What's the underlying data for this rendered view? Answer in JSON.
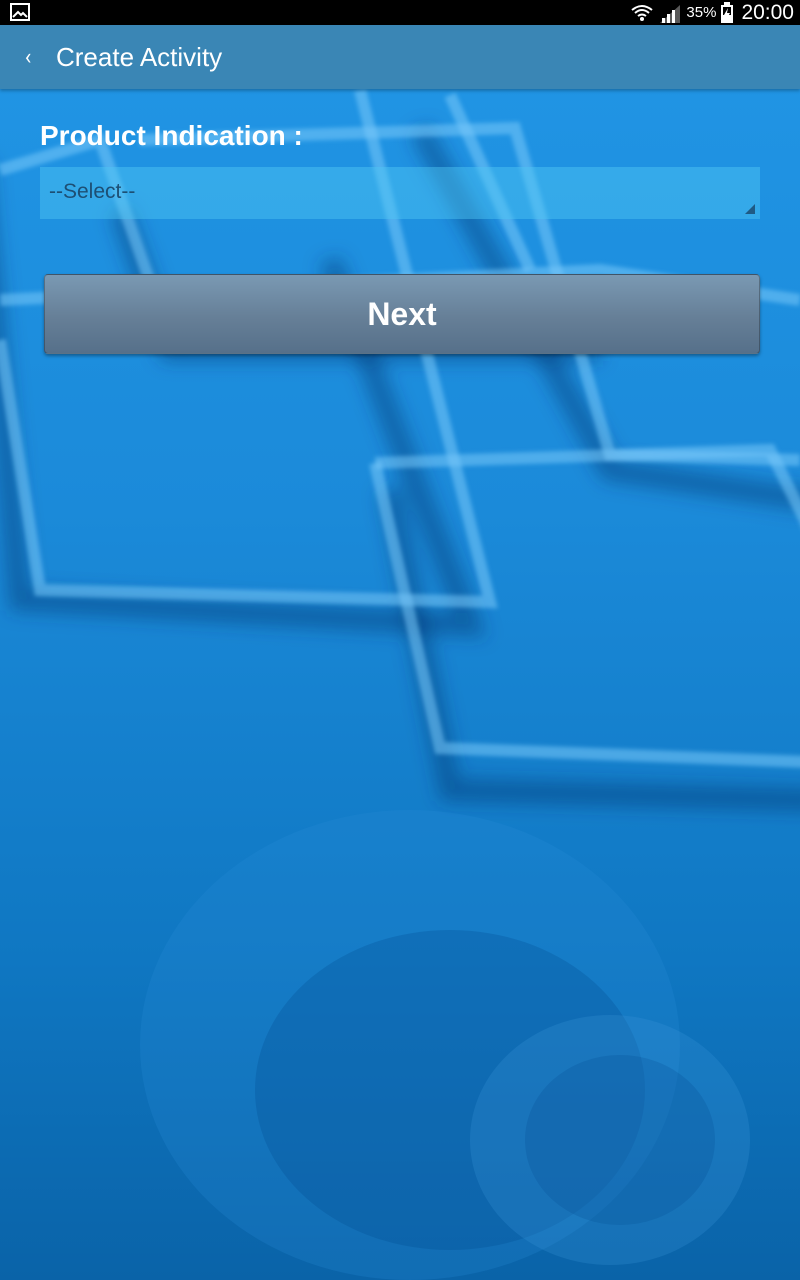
{
  "status_bar": {
    "left_icon": "gallery-icon",
    "wifi_icon": "wifi-icon",
    "signal_icon": "signal-icon",
    "battery_percent": "35%",
    "battery_icon": "battery-charging-icon",
    "time": "20:00"
  },
  "action_bar": {
    "back_icon": "chevron-left-icon",
    "back_glyph": "‹",
    "title": "Create Activity",
    "background_color": "#3a86b5"
  },
  "form": {
    "product_indication_label": "Product Indication :",
    "product_indication_value": "--Select--"
  },
  "buttons": {
    "next_label": "Next"
  },
  "colors": {
    "background_top": "#2196e6",
    "background_bottom": "#0a63a8",
    "button": "#667f97"
  }
}
